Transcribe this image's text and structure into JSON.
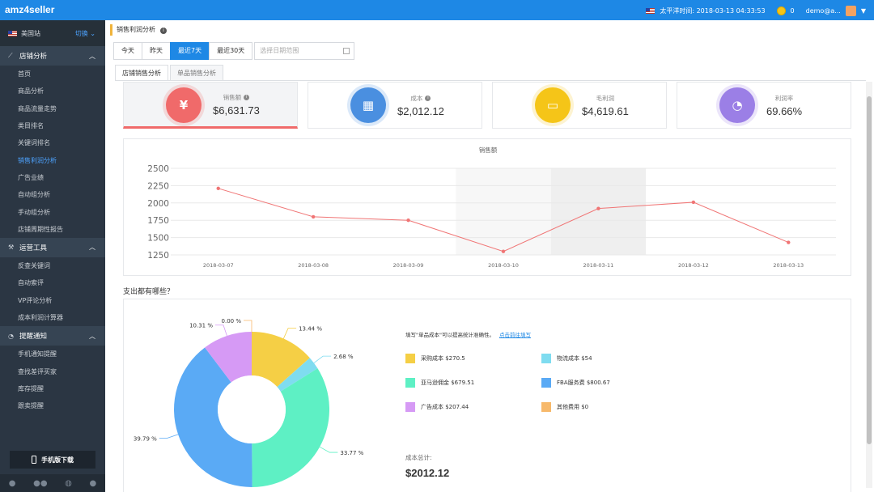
{
  "topbar": {
    "brand": "amz4seller",
    "time_label": "太平洋时间: 2018-03-13 04:33:53",
    "coins": "0",
    "user": "demo@a..."
  },
  "sidebar": {
    "region": "美国站",
    "switch_label": "切换",
    "sections": [
      {
        "title": "店铺分析",
        "icon": "chart-icon",
        "items": [
          "首页",
          "商品分析",
          "商品流量走势",
          "类目排名",
          "关键词排名",
          "销售利润分析",
          "广告业绩",
          "自动组分析",
          "手动组分析",
          "店铺周期性报告"
        ],
        "active_index": 5
      },
      {
        "title": "运营工具",
        "icon": "wrench-icon",
        "items": [
          "反查关键词",
          "自动索评",
          "VP评论分析",
          "成本利润计算器"
        ]
      },
      {
        "title": "提醒通知",
        "icon": "bell-icon",
        "items": [
          "手机通知提醒",
          "查找差评买家",
          "库存提醒",
          "跟卖提醒"
        ]
      }
    ],
    "mobile_download": "手机版下载"
  },
  "main": {
    "page_title": "销售利润分析",
    "date_buttons": [
      "今天",
      "昨天",
      "最近7天",
      "最近30天"
    ],
    "active_date_index": 2,
    "date_placeholder": "选择日期范围",
    "tabs": [
      "店铺销售分析",
      "单品销售分析"
    ],
    "active_tab_index": 0,
    "stats": [
      {
        "label": "销售额",
        "value": "$6,631.73",
        "icon": "money-bag-icon",
        "color": "#f06a6a",
        "info": true
      },
      {
        "label": "成本",
        "value": "$2,012.12",
        "icon": "calculator-icon",
        "color": "#4a8fe0",
        "info": true
      },
      {
        "label": "毛利润",
        "value": "$4,619.61",
        "icon": "wallet-icon",
        "color": "#f5c518",
        "info": false
      },
      {
        "label": "利润率",
        "value": "69.66%",
        "icon": "pie-icon",
        "color": "#9b7fe6",
        "info": false
      }
    ],
    "expense_title": "支出都有哪些？",
    "legend_note": "填写\"单品成本\"可以提高统计准确性。",
    "legend_link": "点击前往填写",
    "total_label": "成本总计:",
    "total_value": "$2012.12"
  },
  "chart_data": [
    {
      "type": "line",
      "title": "销售额",
      "x": [
        "2018-03-07",
        "2018-03-08",
        "2018-03-09",
        "2018-03-10",
        "2018-03-11",
        "2018-03-12",
        "2018-03-13"
      ],
      "series": [
        {
          "values": [
            2210,
            1800,
            1750,
            1300,
            1920,
            2010,
            1430
          ],
          "color": "#f07575"
        }
      ],
      "ylim": [
        1250,
        2500
      ],
      "yticks": [
        1250,
        1500,
        1750,
        2000,
        2250,
        2500
      ],
      "grid": true,
      "highlight_bands": [
        "2018-03-10",
        "2018-03-11"
      ]
    },
    {
      "type": "pie",
      "donut": true,
      "slices": [
        {
          "label": "采购成本 $270.5",
          "value": 13.44,
          "display": "13.44 %",
          "color": "#f5cf45"
        },
        {
          "label": "物流成本 $54",
          "value": 2.68,
          "display": "2.68 %",
          "color": "#7fdcf0"
        },
        {
          "label": "亚马逊佣金 $679.51",
          "value": 33.77,
          "display": "33.77 %",
          "color": "#5ef0c4"
        },
        {
          "label": "FBA服务费 $800.67",
          "value": 39.79,
          "display": "39.79 %",
          "color": "#5aaaf5"
        },
        {
          "label": "广告成本 $207.44",
          "value": 10.31,
          "display": "10.31 %",
          "color": "#d69af5"
        },
        {
          "label": "其他费用 $0",
          "value": 0,
          "display": "0.00 %",
          "color": "#f7b96b"
        }
      ]
    }
  ]
}
